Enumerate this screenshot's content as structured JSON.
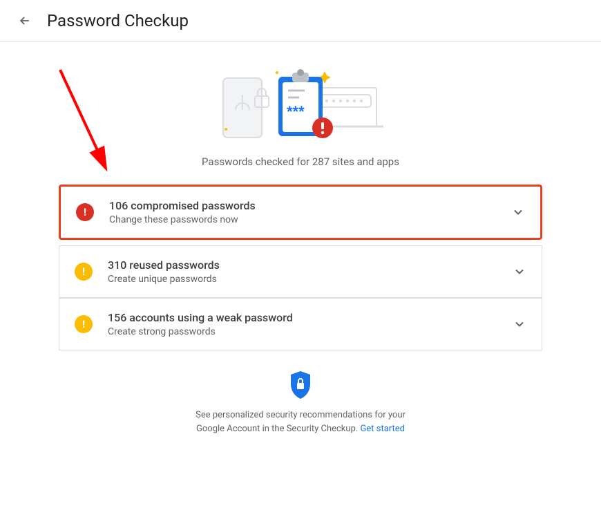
{
  "header": {
    "title": "Password Checkup"
  },
  "hero": {
    "checked_text": "Passwords checked for 287 sites and apps"
  },
  "cards": [
    {
      "severity": "danger",
      "title": "106 compromised passwords",
      "subtitle": "Change these passwords now",
      "highlighted": true
    },
    {
      "severity": "warning",
      "title": "310 reused passwords",
      "subtitle": "Create unique passwords",
      "highlighted": false
    },
    {
      "severity": "warning",
      "title": "156 accounts using a weak password",
      "subtitle": "Create strong passwords",
      "highlighted": false
    }
  ],
  "footer": {
    "text_line1": "See personalized security recommendations for your",
    "text_line2": "Google Account in the Security Checkup. ",
    "link_text": "Get started"
  }
}
